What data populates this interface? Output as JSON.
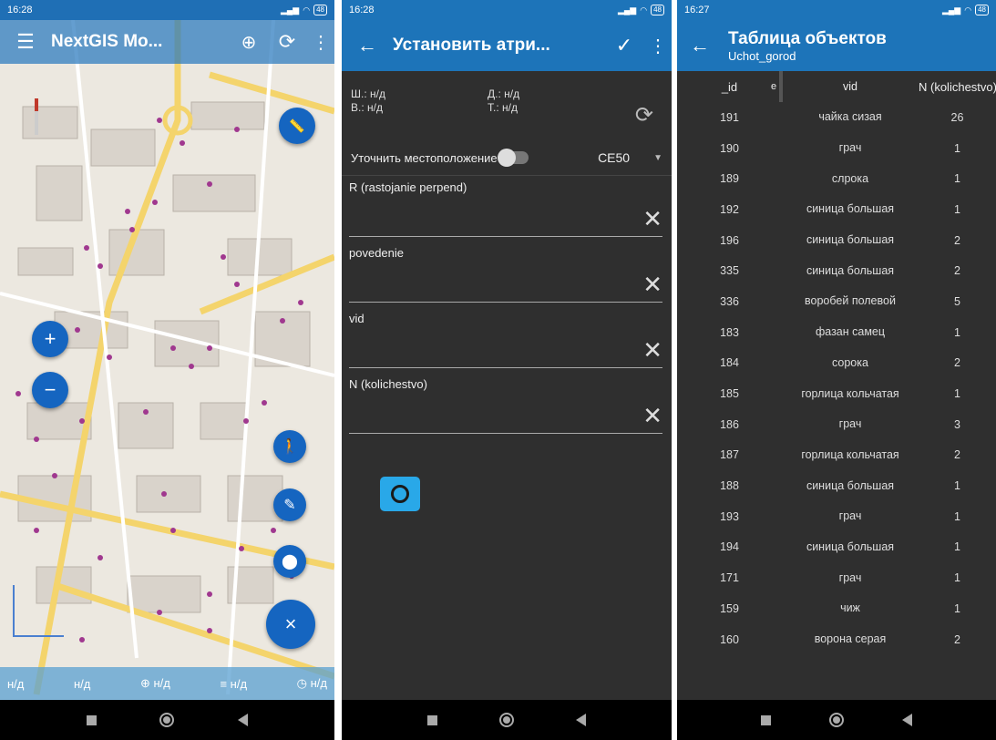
{
  "screen1": {
    "status": {
      "time": "16:28",
      "battery": "48"
    },
    "appbar": {
      "title": "NextGIS Mo..."
    },
    "zoom_in": "+",
    "zoom_out": "−",
    "bottom": {
      "v1": "н/д",
      "v2": "н/д",
      "v3": "н/д",
      "v4": "н/д",
      "v5": "н/д"
    },
    "fab_close": "×"
  },
  "screen2": {
    "status": {
      "time": "16:28",
      "battery": "48"
    },
    "appbar": {
      "title": "Установить атри..."
    },
    "coords": {
      "lat": "Ш.: н/д",
      "lon": "Д.: н/д",
      "alt": "В.: н/д",
      "acc": "Т.: н/д"
    },
    "refine": {
      "label": "Уточнить местоположение",
      "select": "CE50"
    },
    "fields": [
      {
        "label": "R (rastojanie perpend)"
      },
      {
        "label": "povedenie"
      },
      {
        "label": "vid"
      },
      {
        "label": "N (kolichestvo)"
      }
    ],
    "clear_glyph": "✕"
  },
  "screen3": {
    "status": {
      "time": "16:27",
      "battery": "48"
    },
    "appbar": {
      "title": "Таблица объектов",
      "subtitle": "Uchot_gorod"
    },
    "columns": {
      "id": "_id",
      "e": "e",
      "vid": "vid",
      "n": "N (kolichestvo)"
    },
    "rows": [
      {
        "id": "191",
        "vid": "чайка сизая",
        "n": "26"
      },
      {
        "id": "190",
        "vid": "грач",
        "n": "1"
      },
      {
        "id": "189",
        "vid": "слрока",
        "n": "1"
      },
      {
        "id": "192",
        "vid": "синица большая",
        "n": "1"
      },
      {
        "id": "196",
        "vid": "синица большая",
        "n": "2"
      },
      {
        "id": "335",
        "vid": "синица большая",
        "n": "2"
      },
      {
        "id": "336",
        "vid": "воробей полевой",
        "n": "5"
      },
      {
        "id": "183",
        "vid": "фазан самец",
        "n": "1"
      },
      {
        "id": "184",
        "vid": "сорока",
        "n": "2"
      },
      {
        "id": "185",
        "vid": "горлица кольчатая",
        "n": "1"
      },
      {
        "id": "186",
        "vid": "грач",
        "n": "3"
      },
      {
        "id": "187",
        "vid": "горлица кольчатая",
        "n": "2"
      },
      {
        "id": "188",
        "vid": "синица большая",
        "n": "1"
      },
      {
        "id": "193",
        "vid": "грач",
        "n": "1"
      },
      {
        "id": "194",
        "vid": "синица большая",
        "n": "1"
      },
      {
        "id": "171",
        "vid": "грач",
        "n": "1"
      },
      {
        "id": "159",
        "vid": "чиж",
        "n": "1"
      },
      {
        "id": "160",
        "vid": "ворона серая",
        "n": "2"
      }
    ]
  },
  "colors": {
    "primary": "#1d74b9",
    "fab": "#1565c0",
    "dark": "#2f2f2f",
    "poi": "#b03a98",
    "road": "#f7d774"
  }
}
